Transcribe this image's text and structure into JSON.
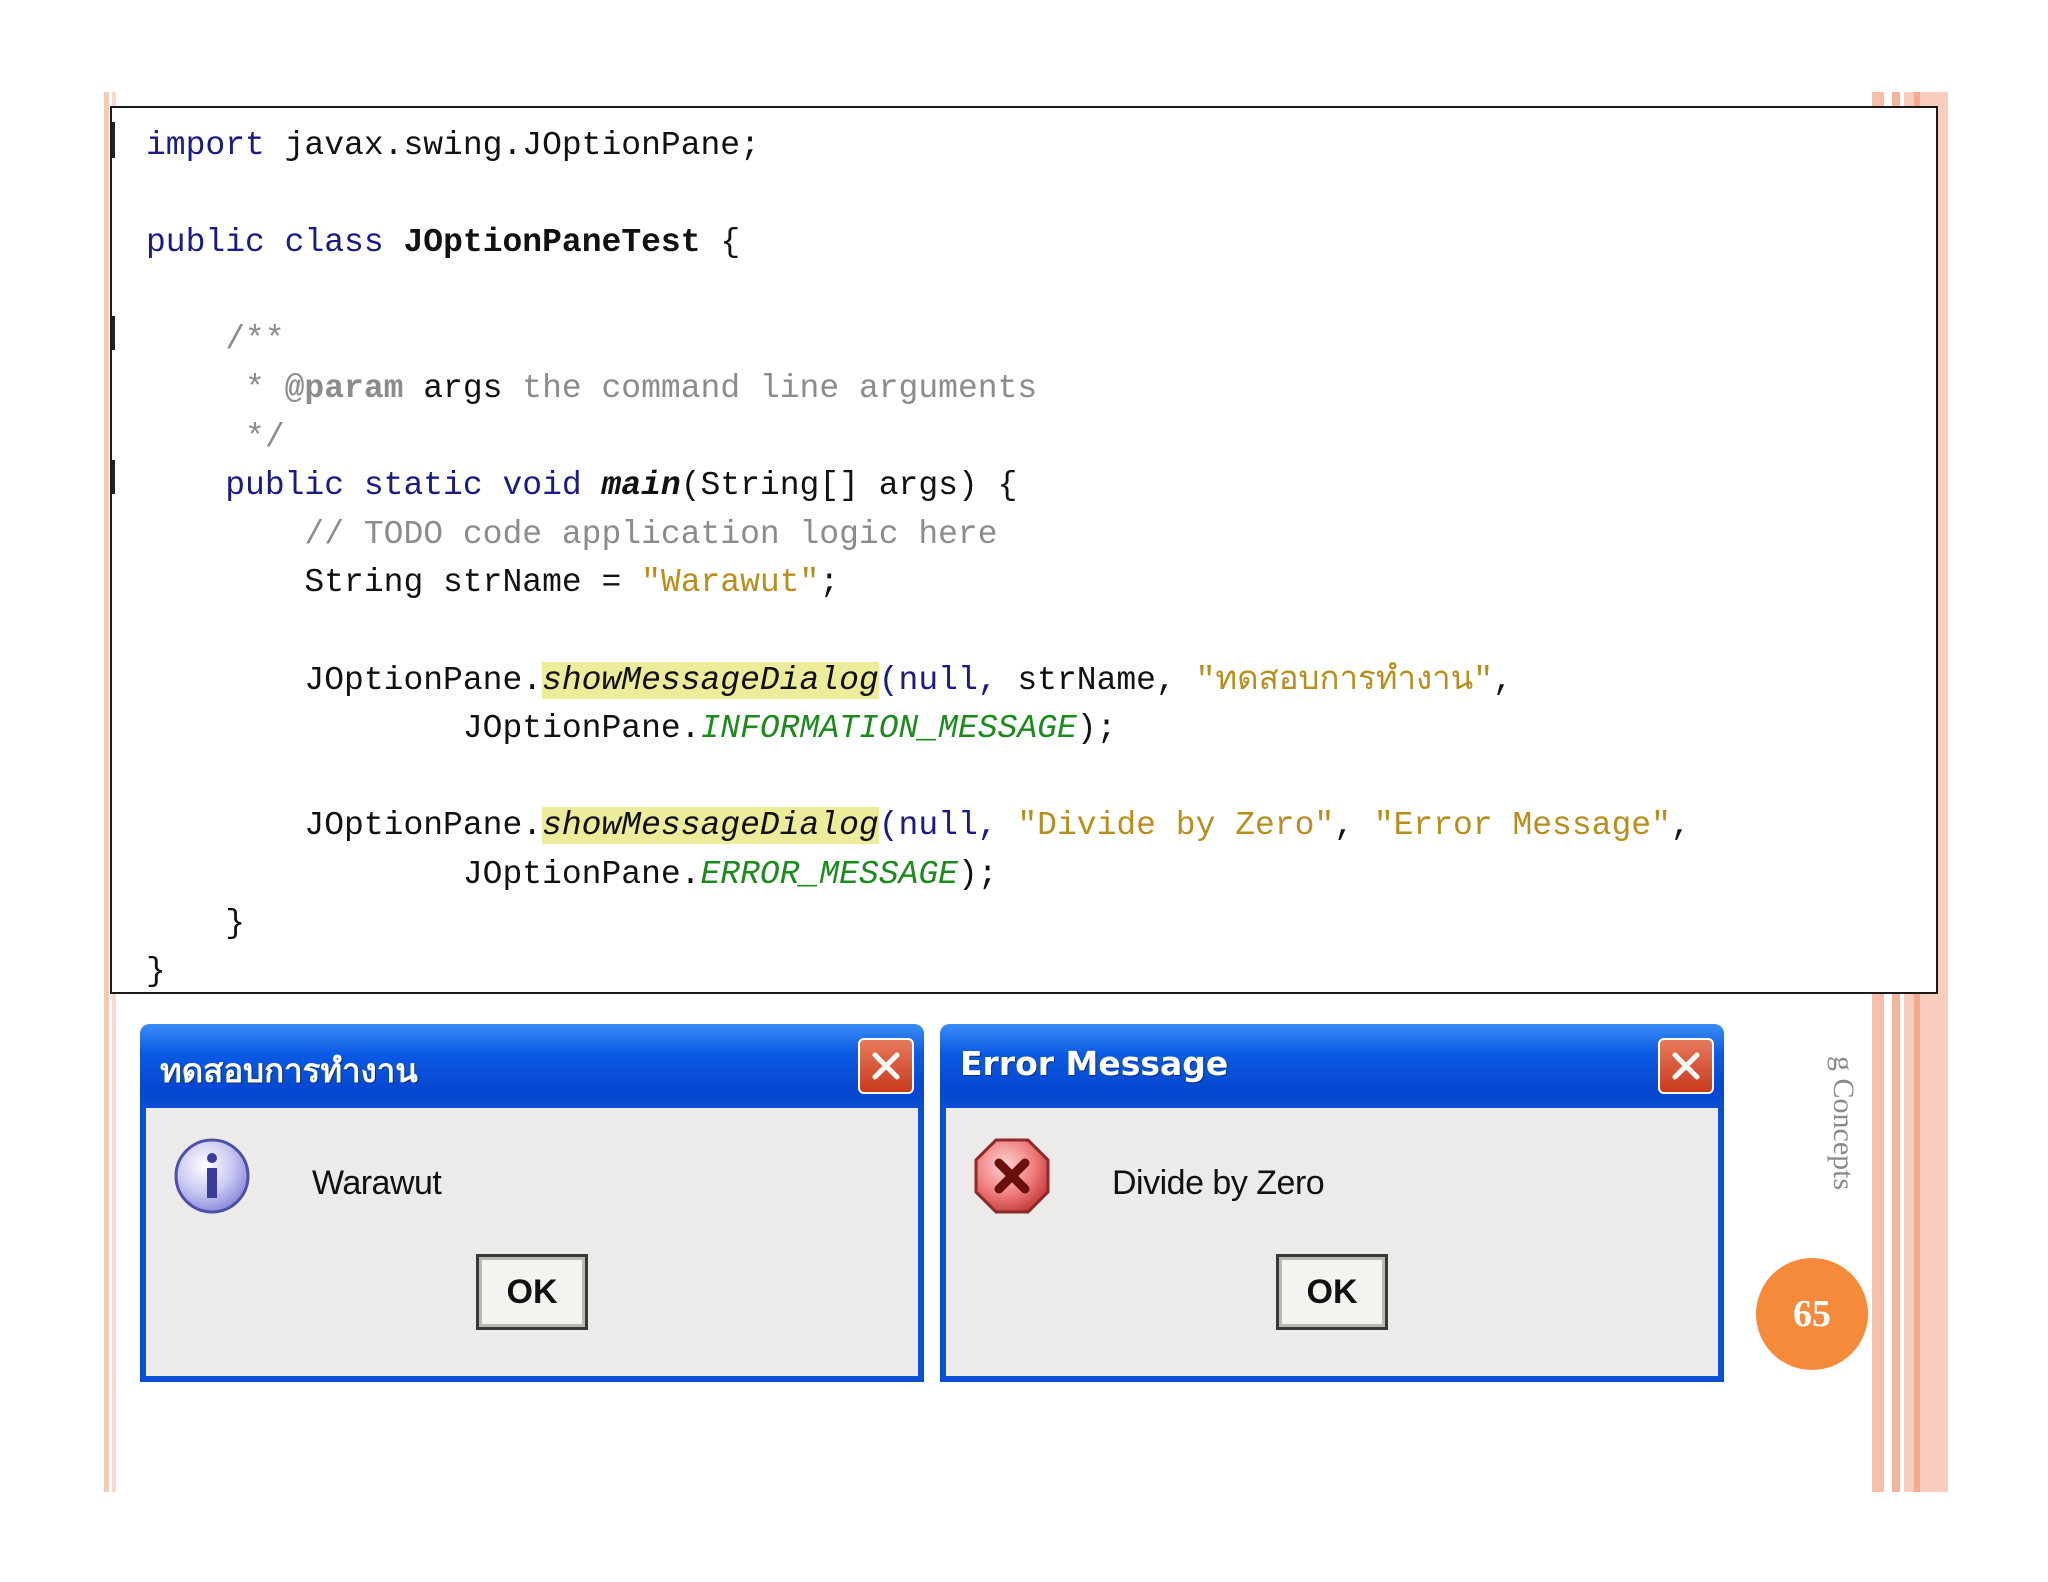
{
  "code": {
    "line1_import": "import",
    "line1_rest": " javax.swing.JOptionPane;",
    "line3_public": "public",
    "line3_class": "class",
    "line3_name": "JOptionPaneTest",
    "line3_brace": " {",
    "line5_comment": "    /**",
    "line6_star": "     * ",
    "line6_tag": "@param",
    "line6_args": " args",
    "line6_desc": " the command line arguments",
    "line7_end": "     */",
    "line8_indent": "    ",
    "line8_mods": "public static void",
    "line8_main": "main",
    "line8_params": "(String[] args) {",
    "line9_comment": "        // TODO code application logic here",
    "line10_decl": "        String strName = ",
    "line10_str": "\"Warawut\"",
    "line10_end": ";",
    "line12_pre": "        JOptionPane.",
    "line12_method": "showMessageDialog",
    "line12_null": "(null,",
    "line12_mid": " strName, ",
    "line12_str": "\"ทดสอบการทำงาน\"",
    "line12_end": ",",
    "line13_pre": "                JOptionPane.",
    "line13_const": "INFORMATION_MESSAGE",
    "line13_end": ");",
    "line15_pre": "        JOptionPane.",
    "line15_method": "showMessageDialog",
    "line15_null": "(null,",
    "line15_str1": " \"Divide by Zero\"",
    "line15_comma": ", ",
    "line15_str2": "\"Error Message\"",
    "line15_end": ",",
    "line16_pre": "                JOptionPane.",
    "line16_const": "ERROR_MESSAGE",
    "line16_end": ");",
    "line17": "    }",
    "line18": "}"
  },
  "dialogs": {
    "info": {
      "title": "ทดสอบการทำงาน",
      "message": "Warawut",
      "ok_label": "OK",
      "icon": "information-icon"
    },
    "error": {
      "title": "Error Message",
      "message": "Divide by Zero",
      "ok_label": "OK",
      "icon": "error-icon"
    }
  },
  "slide": {
    "vertical_caption": "g Concepts",
    "page_number": "65"
  },
  "colors": {
    "accent_orange": "#f58a3b",
    "titlebar_blue": "#0a4fd6",
    "keyword": "#1a1a8c",
    "string": "#b88f1c",
    "constant": "#1d8a1d"
  }
}
